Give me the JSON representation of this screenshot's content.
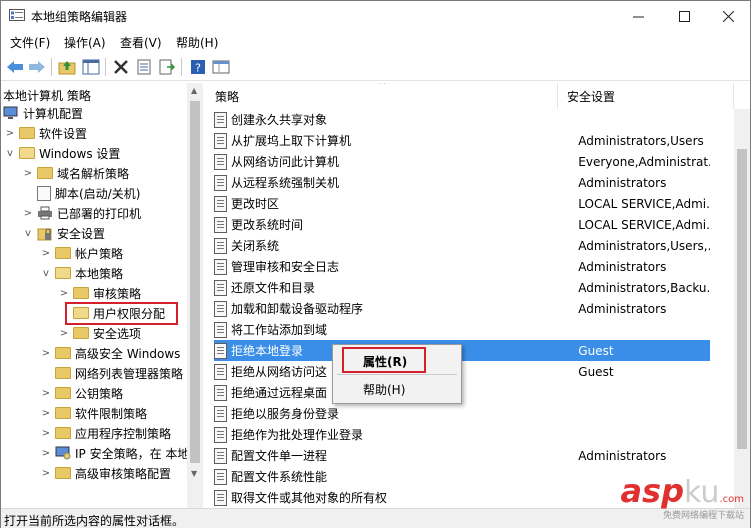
{
  "window": {
    "title": "本地组策略编辑器"
  },
  "menu": [
    "文件(F)",
    "操作(A)",
    "查看(V)",
    "帮助(H)"
  ],
  "tree": {
    "header": "本地计算机 策略",
    "items": [
      {
        "label": "计算机配置"
      },
      {
        "label": "软件设置"
      },
      {
        "label": "Windows 设置"
      },
      {
        "label": "域名解析策略"
      },
      {
        "label": "脚本(启动/关机)"
      },
      {
        "label": "已部署的打印机"
      },
      {
        "label": "安全设置"
      },
      {
        "label": "帐户策略"
      },
      {
        "label": "本地策略"
      },
      {
        "label": "审核策略"
      },
      {
        "label": "用户权限分配"
      },
      {
        "label": "安全选项"
      },
      {
        "label": "高级安全 Windows"
      },
      {
        "label": "网络列表管理器策略"
      },
      {
        "label": "公钥策略"
      },
      {
        "label": "软件限制策略"
      },
      {
        "label": "应用程序控制策略"
      },
      {
        "label": "IP 安全策略，在 本地"
      },
      {
        "label": "高级审核策略配置"
      }
    ]
  },
  "list": {
    "columns": [
      "策略",
      "安全设置"
    ],
    "rows": [
      {
        "name": "创建永久共享对象",
        "sec": ""
      },
      {
        "name": "从扩展坞上取下计算机",
        "sec": "Administrators,Users"
      },
      {
        "name": "从网络访问此计算机",
        "sec": "Everyone,Administrat..."
      },
      {
        "name": "从远程系统强制关机",
        "sec": "Administrators"
      },
      {
        "name": "更改时区",
        "sec": "LOCAL SERVICE,Admi..."
      },
      {
        "name": "更改系统时间",
        "sec": "LOCAL SERVICE,Admi..."
      },
      {
        "name": "关闭系统",
        "sec": "Administrators,Users,..."
      },
      {
        "name": "管理审核和安全日志",
        "sec": "Administrators"
      },
      {
        "name": "还原文件和目录",
        "sec": "Administrators,Backu..."
      },
      {
        "name": "加载和卸载设备驱动程序",
        "sec": "Administrators"
      },
      {
        "name": "将工作站添加到域",
        "sec": ""
      },
      {
        "name": "拒绝本地登录",
        "sec": "Guest"
      },
      {
        "name": "拒绝从网络访问这",
        "sec": "Guest"
      },
      {
        "name": "拒绝通过远程桌面",
        "sec": ""
      },
      {
        "name": "拒绝以服务身份登录",
        "sec": ""
      },
      {
        "name": "拒绝作为批处理作业登录",
        "sec": ""
      },
      {
        "name": "配置文件单一进程",
        "sec": "Administrators"
      },
      {
        "name": "配置文件系统性能",
        "sec": ""
      },
      {
        "name": "取得文件或其他对象的所有权",
        "sec": ""
      }
    ]
  },
  "context_menu": {
    "properties": "属性(R)",
    "help": "帮助(H)"
  },
  "status": "打开当前所选内容的属性对话框。",
  "watermark": {
    "main": "asp",
    "tld": "ku",
    "dotcom": ".com",
    "sub": "免费网络编程下载站"
  }
}
